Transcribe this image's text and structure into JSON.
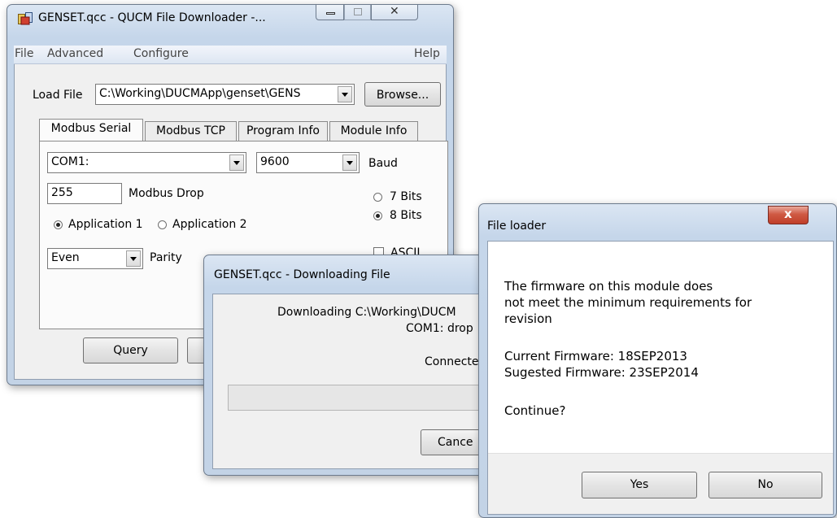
{
  "main_window": {
    "title": "GENSET.qcc - QUCM File Downloader -...",
    "menu": {
      "file": "File",
      "advanced": "Advanced",
      "configure": "Configure",
      "help": "Help"
    },
    "load_file_label": "Load File",
    "load_file_value": "C:\\Working\\DUCMApp\\genset\\GENS",
    "browse_label": "Browse...",
    "tabs": [
      {
        "label": "Modbus Serial"
      },
      {
        "label": "Modbus TCP"
      },
      {
        "label": "Program Info"
      },
      {
        "label": "Module Info"
      }
    ],
    "com_port": "COM1:",
    "baud_value": "9600",
    "baud_label": "Baud",
    "drop_value": "255",
    "drop_label": "Modbus Drop",
    "bits7_label": "7 Bits",
    "bits8_label": "8 Bits",
    "app1_label": "Application 1",
    "app2_label": "Application 2",
    "parity_value": "Even",
    "parity_label": "Parity",
    "ascii_label": "ASCII",
    "query_label": "Query"
  },
  "download_window": {
    "title": "GENSET.qcc - Downloading File",
    "line1": "Downloading C:\\Working\\DUCM",
    "line2": "COM1: drop",
    "status": "Connecte",
    "progress": 0,
    "cancel_label": "Cance"
  },
  "file_loader": {
    "title": "File loader",
    "msg_line1": "The firmware on this module does",
    "msg_line2": "not meet the minimum requirements for",
    "msg_line3": "revision",
    "current_fw": "Current Firmware: 18SEP2013",
    "suggested_fw": "Sugested Firmware: 23SEP2014",
    "question": "Continue?",
    "yes_label": "Yes",
    "no_label": "No",
    "close_symbol": "x"
  }
}
